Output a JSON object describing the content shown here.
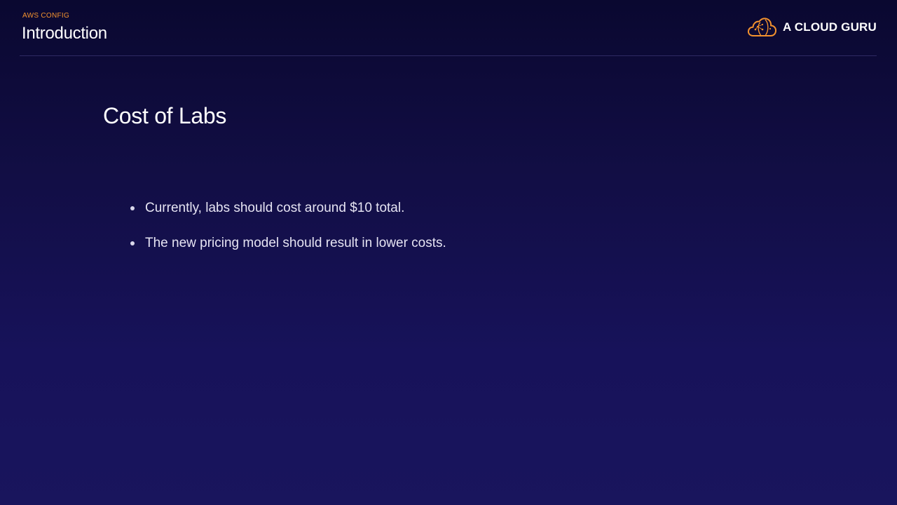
{
  "header": {
    "kicker": "AWS CONFIG",
    "section_title": "Introduction"
  },
  "brand": {
    "name": "A CLOUD GURU",
    "logo_icon": "cloud-brain-icon",
    "accent_color": "#f3922e"
  },
  "main": {
    "heading": "Cost of Labs",
    "bullets": [
      "Currently, labs should cost around $10 total.",
      "The new pricing model should result in lower costs."
    ]
  }
}
